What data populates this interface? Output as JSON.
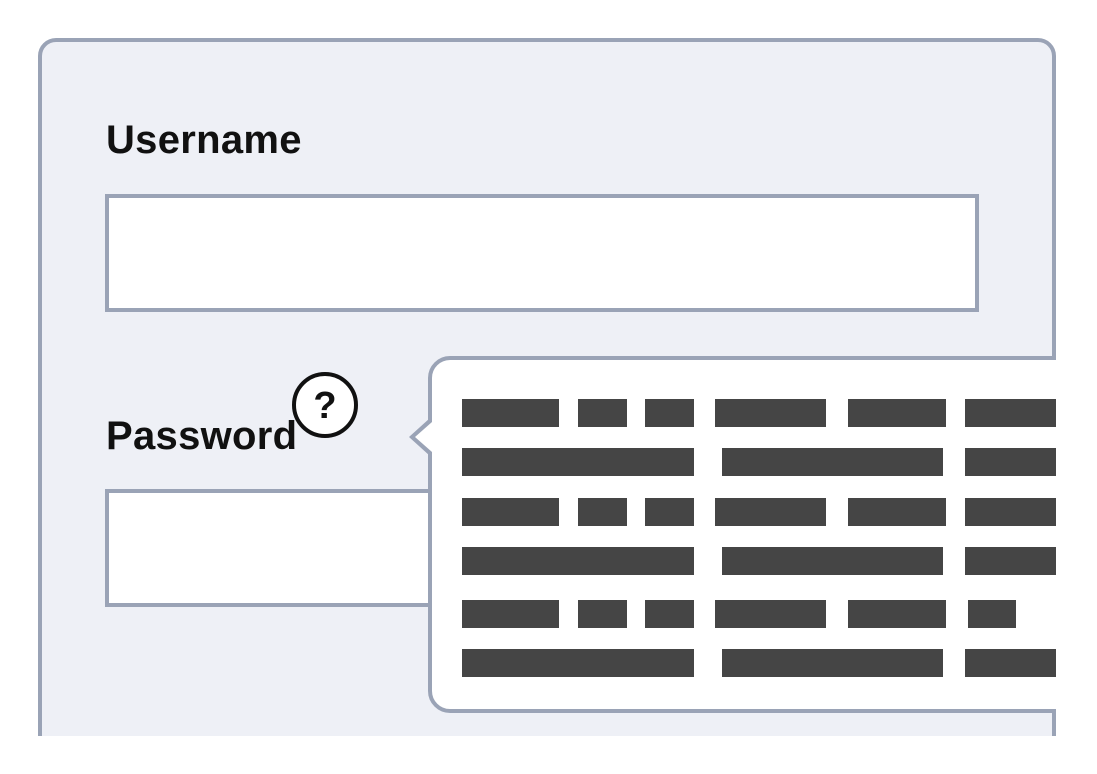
{
  "form": {
    "username_label": "Username",
    "username_value": "",
    "password_label": "Password",
    "password_value": "",
    "help_glyph": "?"
  },
  "tooltip": {
    "content": "redacted-text-blocks",
    "color": "#454545"
  },
  "colors": {
    "panel_background": "#eef0f6",
    "border": "#9aa3b6",
    "text": "#111111"
  },
  "icons": {
    "help": "question-circle-icon"
  }
}
